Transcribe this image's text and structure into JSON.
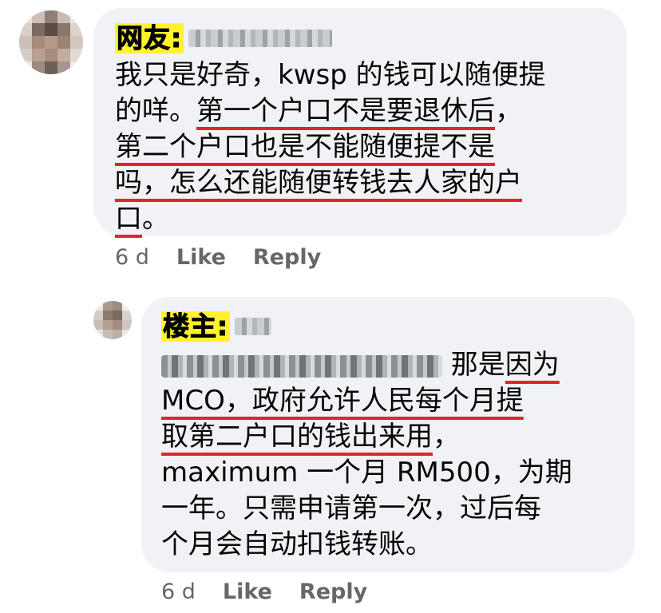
{
  "comments": [
    {
      "tag": "网友:",
      "lines": [
        [
          {
            "t": "我只是好奇，kwsp 的钱可以随便提"
          }
        ],
        [
          {
            "t": "的咩。"
          },
          {
            "t": "第一个户口不是要退休后",
            "u": true
          },
          {
            "t": "，"
          }
        ],
        [
          {
            "t": "第二个户口也是不能随便提不是",
            "u": true
          }
        ],
        [
          {
            "t": "吗，怎么还能随便转钱去人家的户",
            "u": true
          }
        ],
        [
          {
            "t": "口",
            "u": true
          },
          {
            "t": "。"
          }
        ]
      ],
      "time": "6 d",
      "like_label": "Like",
      "reply_label": "Reply"
    },
    {
      "tag": "楼主:",
      "lines": [
        [
          {
            "blur": true
          },
          {
            "t": " 那是"
          },
          {
            "t": "因为",
            "u": true
          }
        ],
        [
          {
            "t": "MCO，政府允许人民每个月提",
            "u": true
          }
        ],
        [
          {
            "t": "取第二户口的钱出来用",
            "u": true
          },
          {
            "t": "，"
          }
        ],
        [
          {
            "t": "maximum 一个月 RM500，为期"
          }
        ],
        [
          {
            "t": "一年。只需申请第一次，过后每"
          }
        ],
        [
          {
            "t": "个月会自动扣钱转账。"
          }
        ]
      ],
      "time": "6 d",
      "like_label": "Like",
      "reply_label": "Reply"
    }
  ],
  "colors": {
    "bubble": "#f0f2f5",
    "highlight": "#fff22b",
    "underline": "#e0252b",
    "meta_text": "#65676b"
  }
}
